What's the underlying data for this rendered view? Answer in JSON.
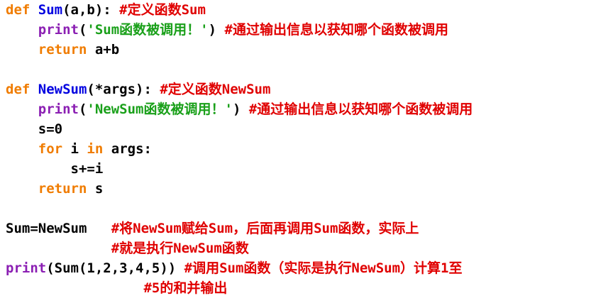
{
  "lines": [
    {
      "tokens": [
        {
          "cls": "kw",
          "text": "def "
        },
        {
          "cls": "fn",
          "text": "Sum"
        },
        {
          "cls": "txt",
          "text": "(a,b): "
        },
        {
          "cls": "cm",
          "text": "#定义函数Sum"
        }
      ]
    },
    {
      "tokens": [
        {
          "cls": "txt",
          "text": "    "
        },
        {
          "cls": "bi",
          "text": "print"
        },
        {
          "cls": "txt",
          "text": "("
        },
        {
          "cls": "str",
          "text": "'Sum函数被调用！'"
        },
        {
          "cls": "txt",
          "text": ") "
        },
        {
          "cls": "cm",
          "text": "#通过输出信息以获知哪个函数被调用"
        }
      ]
    },
    {
      "tokens": [
        {
          "cls": "txt",
          "text": "    "
        },
        {
          "cls": "kw",
          "text": "return"
        },
        {
          "cls": "txt",
          "text": " a+b"
        }
      ]
    },
    {
      "tokens": []
    },
    {
      "tokens": [
        {
          "cls": "kw",
          "text": "def "
        },
        {
          "cls": "fn",
          "text": "NewSum"
        },
        {
          "cls": "txt",
          "text": "(*args): "
        },
        {
          "cls": "cm",
          "text": "#定义函数NewSum"
        }
      ]
    },
    {
      "tokens": [
        {
          "cls": "txt",
          "text": "    "
        },
        {
          "cls": "bi",
          "text": "print"
        },
        {
          "cls": "txt",
          "text": "("
        },
        {
          "cls": "str",
          "text": "'NewSum函数被调用！'"
        },
        {
          "cls": "txt",
          "text": ") "
        },
        {
          "cls": "cm",
          "text": "#通过输出信息以获知哪个函数被调用"
        }
      ]
    },
    {
      "tokens": [
        {
          "cls": "txt",
          "text": "    s=0"
        }
      ]
    },
    {
      "tokens": [
        {
          "cls": "txt",
          "text": "    "
        },
        {
          "cls": "kw",
          "text": "for"
        },
        {
          "cls": "txt",
          "text": " i "
        },
        {
          "cls": "kw",
          "text": "in"
        },
        {
          "cls": "txt",
          "text": " args:"
        }
      ]
    },
    {
      "tokens": [
        {
          "cls": "txt",
          "text": "        s+=i"
        }
      ]
    },
    {
      "tokens": [
        {
          "cls": "txt",
          "text": "    "
        },
        {
          "cls": "kw",
          "text": "return"
        },
        {
          "cls": "txt",
          "text": " s"
        }
      ]
    },
    {
      "tokens": []
    },
    {
      "tokens": [
        {
          "cls": "txt",
          "text": "Sum=NewSum   "
        },
        {
          "cls": "cm",
          "text": "#将NewSum赋给Sum，后面再调用Sum函数，实际上"
        }
      ]
    },
    {
      "tokens": [
        {
          "cls": "txt",
          "text": "             "
        },
        {
          "cls": "cm",
          "text": "#就是执行NewSum函数"
        }
      ]
    },
    {
      "tokens": [
        {
          "cls": "bi",
          "text": "print"
        },
        {
          "cls": "txt",
          "text": "(Sum(1,2,3,4,5)) "
        },
        {
          "cls": "cm",
          "text": "#调用Sum函数（实际是执行NewSum）计算1至"
        }
      ]
    },
    {
      "tokens": [
        {
          "cls": "txt",
          "text": "                 "
        },
        {
          "cls": "cm",
          "text": "#5的和并输出"
        }
      ]
    }
  ]
}
